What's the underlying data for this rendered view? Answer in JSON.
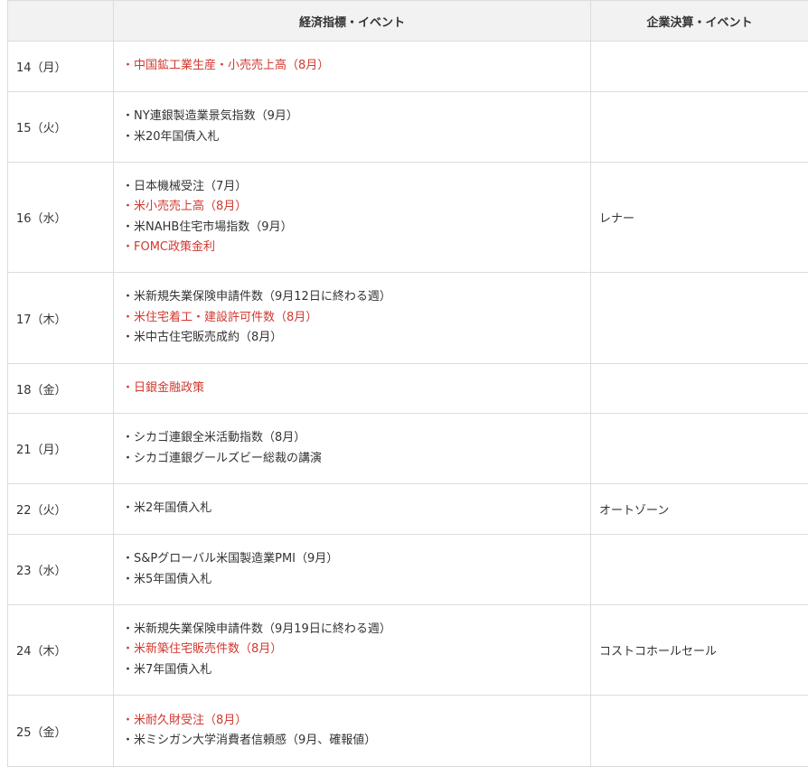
{
  "header": {
    "date": "",
    "econ": "経済指標・イベント",
    "corp": "企業決算・イベント"
  },
  "rows": [
    {
      "date": "14（月）",
      "corp": "",
      "items": [
        {
          "text": "・中国鉱工業生産・小売売上高（8月）",
          "highlight": true
        }
      ]
    },
    {
      "date": "15（火）",
      "corp": "",
      "items": [
        {
          "text": "・NY連銀製造業景気指数（9月）",
          "highlight": false
        },
        {
          "text": "・米20年国債入札",
          "highlight": false
        }
      ]
    },
    {
      "date": "16（水）",
      "corp": "レナー",
      "items": [
        {
          "text": "・日本機械受注（7月）",
          "highlight": false
        },
        {
          "text": "・米小売売上高（8月）",
          "highlight": true
        },
        {
          "text": "・米NAHB住宅市場指数（9月）",
          "highlight": false
        },
        {
          "text": "・FOMC政策金利",
          "highlight": true
        }
      ]
    },
    {
      "date": "17（木）",
      "corp": "",
      "items": [
        {
          "text": "・米新規失業保険申請件数（9月12日に終わる週）",
          "highlight": false
        },
        {
          "text": "・米住宅着工・建設許可件数（8月）",
          "highlight": true
        },
        {
          "text": "・米中古住宅販売成約（8月）",
          "highlight": false
        }
      ]
    },
    {
      "date": "18（金）",
      "corp": "",
      "items": [
        {
          "text": "・日銀金融政策",
          "highlight": true
        }
      ]
    },
    {
      "date": "21（月）",
      "corp": "",
      "items": [
        {
          "text": "・シカゴ連銀全米活動指数（8月）",
          "highlight": false
        },
        {
          "text": "・シカゴ連銀グールズビー総裁の講演",
          "highlight": false
        }
      ]
    },
    {
      "date": "22（火）",
      "corp": "オートゾーン",
      "items": [
        {
          "text": "・米2年国債入札",
          "highlight": false
        }
      ]
    },
    {
      "date": "23（水）",
      "corp": "",
      "items": [
        {
          "text": "・S&Pグローバル米国製造業PMI（9月）",
          "highlight": false
        },
        {
          "text": "・米5年国債入札",
          "highlight": false
        }
      ]
    },
    {
      "date": "24（木）",
      "corp": "コストコホールセール",
      "items": [
        {
          "text": "・米新規失業保険申請件数（9月19日に終わる週）",
          "highlight": false
        },
        {
          "text": "・米新築住宅販売件数（8月）",
          "highlight": true
        },
        {
          "text": "・米7年国債入札",
          "highlight": false
        }
      ]
    },
    {
      "date": "25（金）",
      "corp": "",
      "items": [
        {
          "text": "・米耐久財受注（8月）",
          "highlight": true
        },
        {
          "text": "・米ミシガン大学消費者信頼感（9月、確報値）",
          "highlight": false
        }
      ]
    }
  ],
  "colors": {
    "highlight": "#d0392f",
    "text": "#333333",
    "header_bg": "#f2f2f2",
    "border": "#dcdcdc"
  }
}
